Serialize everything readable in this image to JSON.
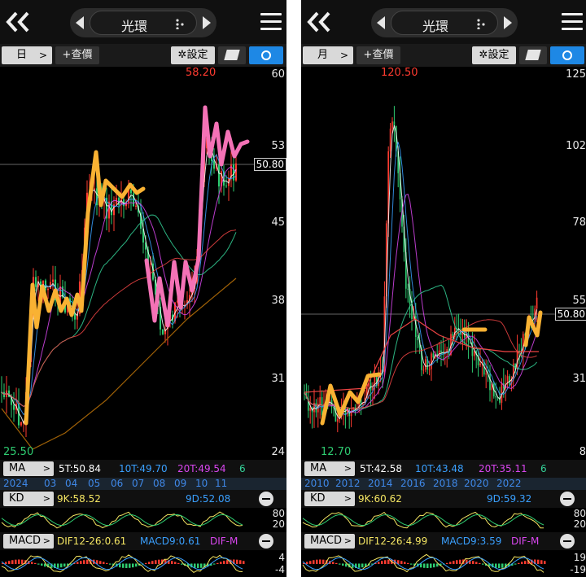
{
  "panels": [
    {
      "id": "daily",
      "stock_name": "光環",
      "period": "日",
      "add_price_label": "+查價",
      "settings_label": "設定",
      "high_label": "58.20",
      "low_label": "25.50",
      "current_price": "50.80",
      "y_axis": [
        "60",
        "53",
        "45",
        "38",
        "31",
        "24"
      ],
      "ma": {
        "tag": "MA",
        "items": [
          "5T:50.84",
          "10T:49.70",
          "20T:49.54",
          "6"
        ]
      },
      "time_axis": [
        "2024",
        "03",
        "04",
        "05",
        "06",
        "07",
        "08",
        "09",
        "10",
        "11"
      ],
      "kd": {
        "tag": "KD",
        "k": "9K:58.52",
        "d": "9D:52.08",
        "levels": [
          "80",
          "20"
        ]
      },
      "macd": {
        "tag": "MACD",
        "dif": "DIF12-26:0.61",
        "macd": "MACD9:0.61",
        "difm": "DIF-M",
        "levels": [
          "4",
          "-4"
        ]
      }
    },
    {
      "id": "monthly",
      "stock_name": "光環",
      "period": "月",
      "add_price_label": "+查價",
      "settings_label": "設定",
      "high_label": "120.50",
      "low_label": "12.70",
      "current_price": "50.80",
      "y_axis": [
        "125",
        "102",
        "78",
        "55",
        "31",
        "8"
      ],
      "ma": {
        "tag": "MA",
        "items": [
          "5T:42.58",
          "10T:43.48",
          "20T:35.11",
          "6"
        ]
      },
      "time_axis": [
        "2010",
        "2012",
        "2014",
        "2016",
        "2018",
        "2020",
        "2022"
      ],
      "kd": {
        "tag": "KD",
        "k": "9K:60.62",
        "d": "9D:59.32",
        "levels": [
          "80",
          "20"
        ]
      },
      "macd": {
        "tag": "MACD",
        "dif": "DIF12-26:4.99",
        "macd": "MACD9:3.59",
        "difm": "DIF-M",
        "levels": [
          "19",
          "-19"
        ]
      }
    }
  ],
  "colors": {
    "up": "#ff3b30",
    "down": "#2ecc71",
    "ma5": "#ffffff",
    "ma10": "#3aa0ff",
    "ma20": "#d946ef",
    "ma60": "#34d399",
    "ma120": "#ef4444",
    "ma240": "#a16207",
    "annot_orange": "#f9b233",
    "annot_pink": "#f472b6",
    "accent_blue": "#1e88e5"
  },
  "icons": [
    "double-chevron-left-icon",
    "menu-icon",
    "gear-icon",
    "draw-icon",
    "crosshair-icon",
    "dots-icon",
    "minus-icon"
  ]
}
